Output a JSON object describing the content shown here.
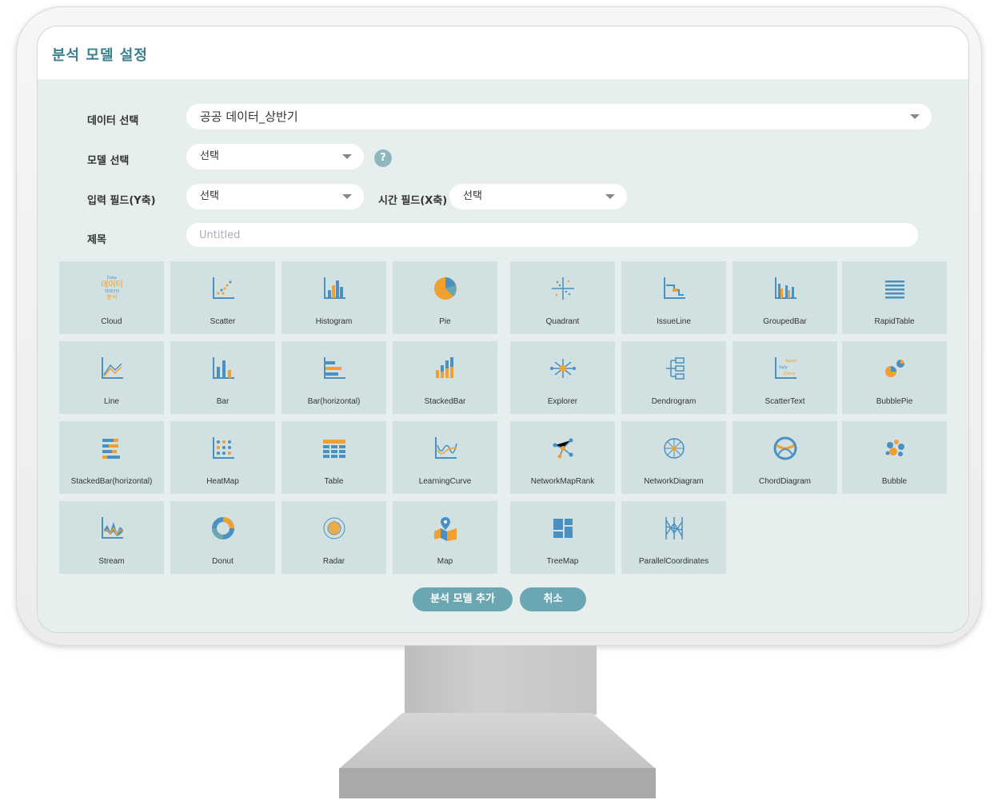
{
  "dialog": {
    "title": "분석 모델 설정"
  },
  "form": {
    "data_label": "데이터 선택",
    "data_value": "공공 데이터_상반기",
    "model_label": "모델 선택",
    "model_value": "선택",
    "help_glyph": "?",
    "y_label": "입력 필드(Y축)",
    "y_value": "선택",
    "x_label": "시간 필드(X축)",
    "x_value": "선택",
    "title_label": "제목",
    "title_placeholder": "Untitled"
  },
  "tiles": [
    {
      "label": "Cloud",
      "icon": "cloud-icon"
    },
    {
      "label": "Scatter",
      "icon": "scatter-icon"
    },
    {
      "label": "Histogram",
      "icon": "histogram-icon"
    },
    {
      "label": "Pie",
      "icon": "pie-icon"
    },
    {
      "label": "Quadrant",
      "icon": "quadrant-icon"
    },
    {
      "label": "IssueLine",
      "icon": "issueline-icon"
    },
    {
      "label": "GroupedBar",
      "icon": "groupedbar-icon"
    },
    {
      "label": "RapidTable",
      "icon": "rapidtable-icon"
    },
    {
      "label": "Line",
      "icon": "line-icon"
    },
    {
      "label": "Bar",
      "icon": "bar-icon"
    },
    {
      "label": "Bar(horizontal)",
      "icon": "bar-horizontal-icon"
    },
    {
      "label": "StackedBar",
      "icon": "stackedbar-icon"
    },
    {
      "label": "Explorer",
      "icon": "explorer-icon"
    },
    {
      "label": "Dendrogram",
      "icon": "dendrogram-icon"
    },
    {
      "label": "ScatterText",
      "icon": "scattertext-icon"
    },
    {
      "label": "BubblePie",
      "icon": "bubblepie-icon"
    },
    {
      "label": "StackedBar(horizontal)",
      "icon": "stackedbar-horizontal-icon"
    },
    {
      "label": "HeatMap",
      "icon": "heatmap-icon"
    },
    {
      "label": "Table",
      "icon": "table-icon"
    },
    {
      "label": "LearningCurve",
      "icon": "learningcurve-icon"
    },
    {
      "label": "NetworkMapRank",
      "icon": "networkmaprank-icon"
    },
    {
      "label": "NetworkDiagram",
      "icon": "networkdiagram-icon"
    },
    {
      "label": "ChordDiagram",
      "icon": "chorddiagram-icon"
    },
    {
      "label": "Bubble",
      "icon": "bubble-icon"
    },
    {
      "label": "Stream",
      "icon": "stream-icon"
    },
    {
      "label": "Donut",
      "icon": "donut-icon"
    },
    {
      "label": "Radar",
      "icon": "radar-icon"
    },
    {
      "label": "Map",
      "icon": "map-icon"
    },
    {
      "label": "TreeMap",
      "icon": "treemap-icon"
    },
    {
      "label": "ParallelCoordinates",
      "icon": "parallelcoordinates-icon"
    }
  ],
  "cloud_icon_text": {
    "line1": "Data",
    "line2": "데이터",
    "line3": "빅데이터",
    "line4": "분석"
  },
  "scattertext_icon_text": {
    "line1": "Apple",
    "line2": "Italy",
    "line3": "China"
  },
  "buttons": {
    "add": "분석 모델 추가",
    "cancel": "취소"
  },
  "colors": {
    "accent": "#6aa7b2",
    "title": "#3a7f8c",
    "tile": "#d1e0e0",
    "icon_blue": "#4a90c0",
    "icon_orange": "#f0a030"
  }
}
